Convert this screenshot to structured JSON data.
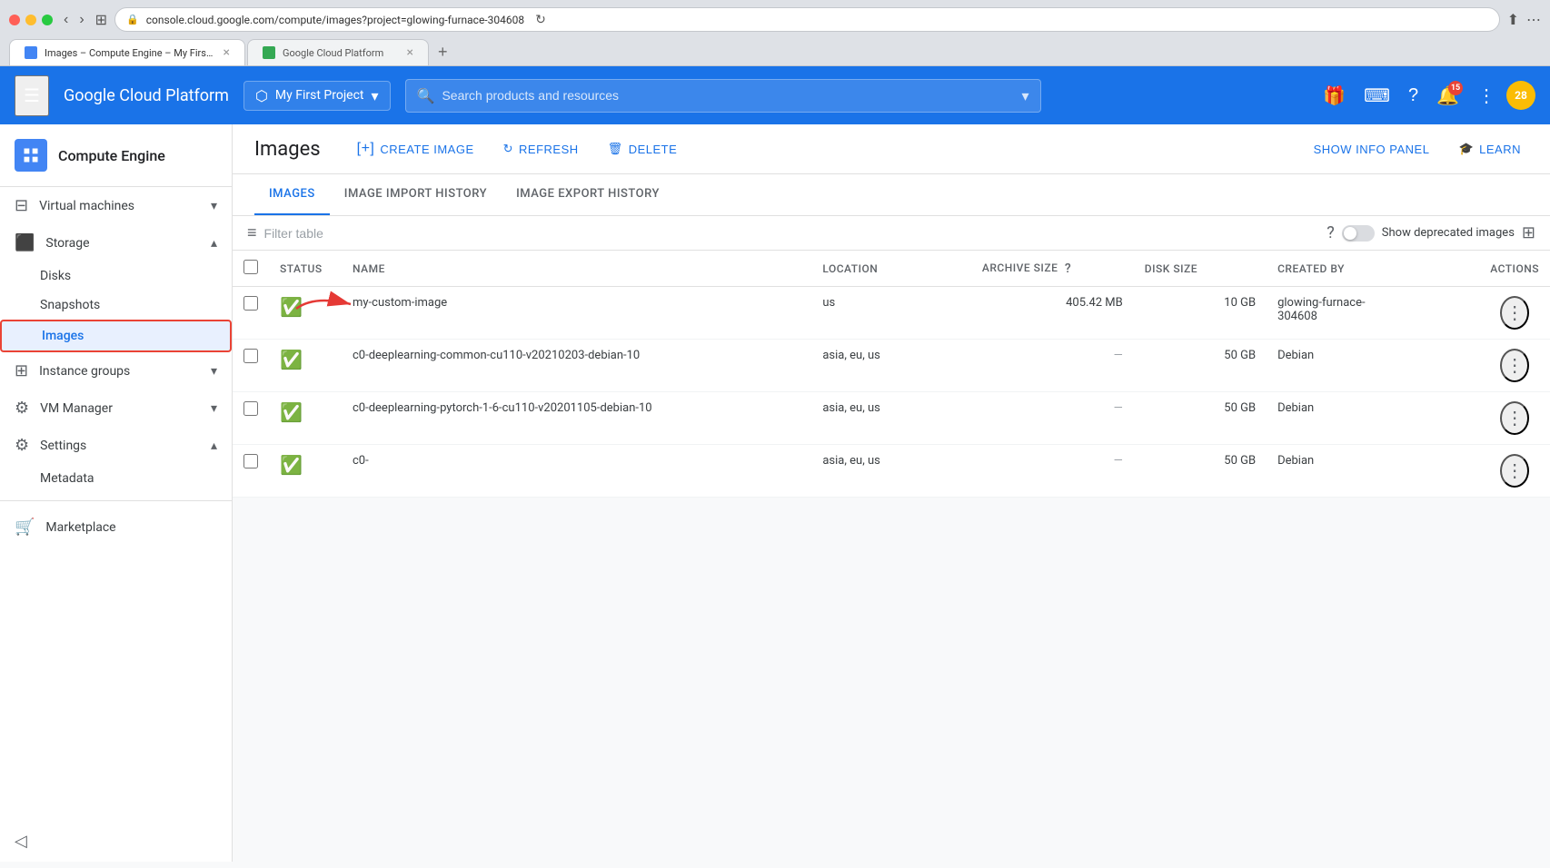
{
  "browser": {
    "url": "console.cloud.google.com/compute/images?project=glowing-furnace-304608",
    "tab1_title": "Images – Compute Engine – My First Project – Google Cloud Platform",
    "tab2_title": "Google Cloud Platform"
  },
  "topnav": {
    "brand": "Google Cloud Platform",
    "project_name": "My First Project",
    "search_placeholder": "Search products and resources",
    "notification_count": "15",
    "avatar_text": "28"
  },
  "sidebar": {
    "engine_title": "Compute Engine",
    "items": [
      {
        "label": "Virtual machines",
        "has_children": true
      },
      {
        "label": "Storage",
        "has_children": true,
        "expanded": true
      },
      {
        "label": "Disks",
        "sub": true
      },
      {
        "label": "Snapshots",
        "sub": true
      },
      {
        "label": "Images",
        "sub": true,
        "active": true
      },
      {
        "label": "Instance groups",
        "has_children": true
      },
      {
        "label": "VM Manager",
        "has_children": true
      },
      {
        "label": "Settings",
        "has_children": true,
        "expanded": true
      },
      {
        "label": "Metadata",
        "sub": true
      },
      {
        "label": "Marketplace"
      }
    ]
  },
  "page": {
    "title": "Images",
    "actions": {
      "create": "CREATE IMAGE",
      "refresh": "REFRESH",
      "delete": "DELETE",
      "show_info": "SHOW INFO PANEL",
      "learn": "LEARN"
    },
    "tabs": [
      {
        "label": "IMAGES",
        "active": true
      },
      {
        "label": "IMAGE IMPORT HISTORY",
        "active": false
      },
      {
        "label": "IMAGE EXPORT HISTORY",
        "active": false
      }
    ]
  },
  "toolbar": {
    "filter_placeholder": "Filter table",
    "toggle_label": "Show deprecated images"
  },
  "table": {
    "columns": [
      {
        "key": "status",
        "label": "Status"
      },
      {
        "key": "name",
        "label": "Name"
      },
      {
        "key": "location",
        "label": "Location"
      },
      {
        "key": "archive_size",
        "label": "Archive size",
        "help": true
      },
      {
        "key": "disk_size",
        "label": "Disk size"
      },
      {
        "key": "created_by",
        "label": "Created by"
      },
      {
        "key": "actions",
        "label": "Actions"
      }
    ],
    "rows": [
      {
        "status": "ok",
        "name": "my-custom-image",
        "location": "us",
        "archive_size": "405.42 MB",
        "disk_size": "10 GB",
        "created_by": "glowing-furnace-304608",
        "has_arrow": true
      },
      {
        "status": "ok",
        "name": "c0-deeplearning-common-cu110-v20210203-debian-10",
        "location": "asia, eu, us",
        "archive_size": "—",
        "disk_size": "50 GB",
        "created_by": "Debian",
        "has_arrow": false
      },
      {
        "status": "ok",
        "name": "c0-deeplearning-pytorch-1-6-cu110-v20201105-debian-10",
        "location": "asia, eu, us",
        "archive_size": "—",
        "disk_size": "50 GB",
        "created_by": "Debian",
        "has_arrow": false
      },
      {
        "status": "ok",
        "name": "c0-",
        "location": "asia, eu, us",
        "archive_size": "—",
        "disk_size": "50 GB",
        "created_by": "Debian",
        "has_arrow": false,
        "partial": true
      }
    ]
  }
}
